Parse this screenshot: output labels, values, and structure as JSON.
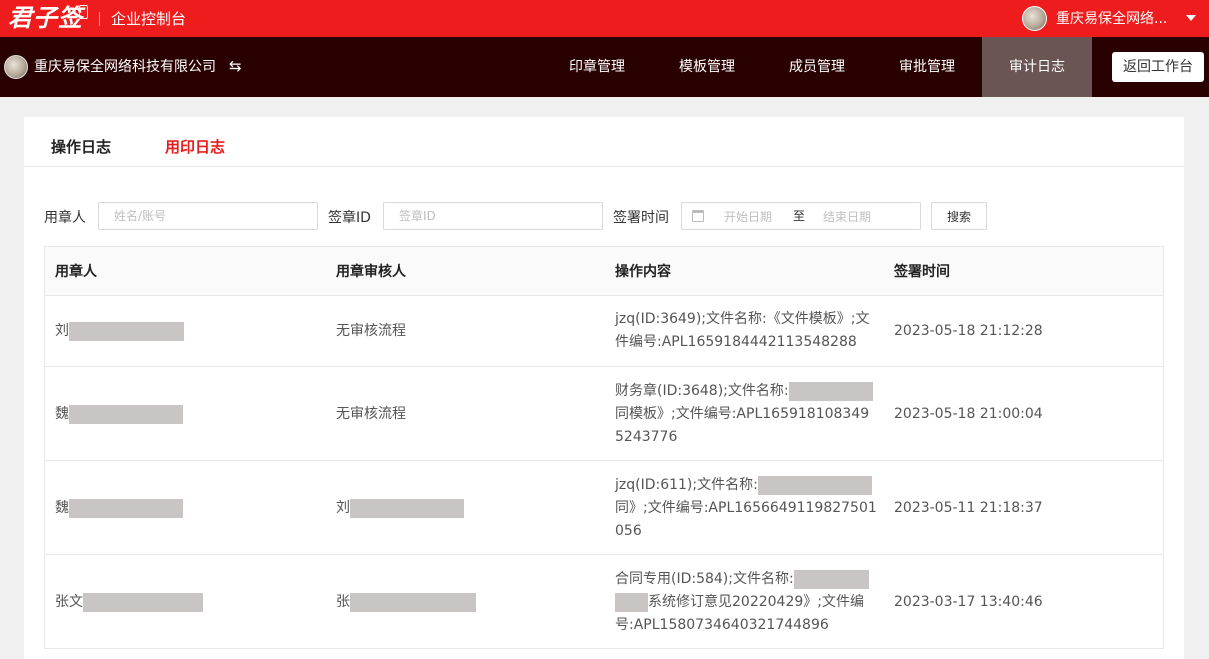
{
  "topbar": {
    "logo_text": "君子签",
    "console_title": "企业控制台",
    "user_name": "重庆易保全网络...",
    "colors": {
      "brand_red": "#ee1c1c"
    }
  },
  "navbar": {
    "company_name": "重庆易保全网络科技有限公司",
    "switch_icon": "⇆",
    "items": [
      {
        "label": "印章管理"
      },
      {
        "label": "模板管理"
      },
      {
        "label": "成员管理"
      },
      {
        "label": "审批管理"
      },
      {
        "label": "审计日志",
        "active": true
      }
    ],
    "back_button": "返回工作台",
    "colors": {
      "background": "#2a0101",
      "active_item": "#6a5454"
    }
  },
  "tabs": [
    {
      "label": "操作日志",
      "active": false
    },
    {
      "label": "用印日志",
      "active": true
    }
  ],
  "filters": {
    "user_label": "用章人",
    "user_placeholder": "姓名/账号",
    "seal_id_label": "签章ID",
    "seal_id_placeholder": "签章ID",
    "time_label": "签署时间",
    "date_start_placeholder": "开始日期",
    "date_separator": "至",
    "date_end_placeholder": "结束日期",
    "search_button": "搜索"
  },
  "table": {
    "headers": [
      "用章人",
      "用章审核人",
      "操作内容",
      "签署时间"
    ],
    "rows": [
      {
        "user": "刘",
        "reviewer": "无审核流程",
        "content": "jzq(ID:3649);文件名称:《文件模板》;文件编号:APL1659184442113548288",
        "time": "2023-05-18 21:12:28"
      },
      {
        "user": "魏",
        "reviewer": "无审核流程",
        "content_prefix": "财务章(ID:3648);文件名称:",
        "content_suffix": "同模板》;文件编号:APL1659181083495243776",
        "time": "2023-05-18 21:00:04"
      },
      {
        "user": "魏",
        "reviewer": "刘",
        "content_prefix": "jzq(ID:611);文件名称:",
        "content_suffix": "同》;文件编号:APL1656649119827501056",
        "time": "2023-05-11 21:18:37"
      },
      {
        "user": "张文",
        "reviewer": "张",
        "content_prefix": "合同专用(ID:584);文件名称:",
        "content_suffix": "系统修订意见20220429》;文件编号:APL1580734640321744896",
        "time": "2023-03-17 13:40:46"
      }
    ]
  }
}
